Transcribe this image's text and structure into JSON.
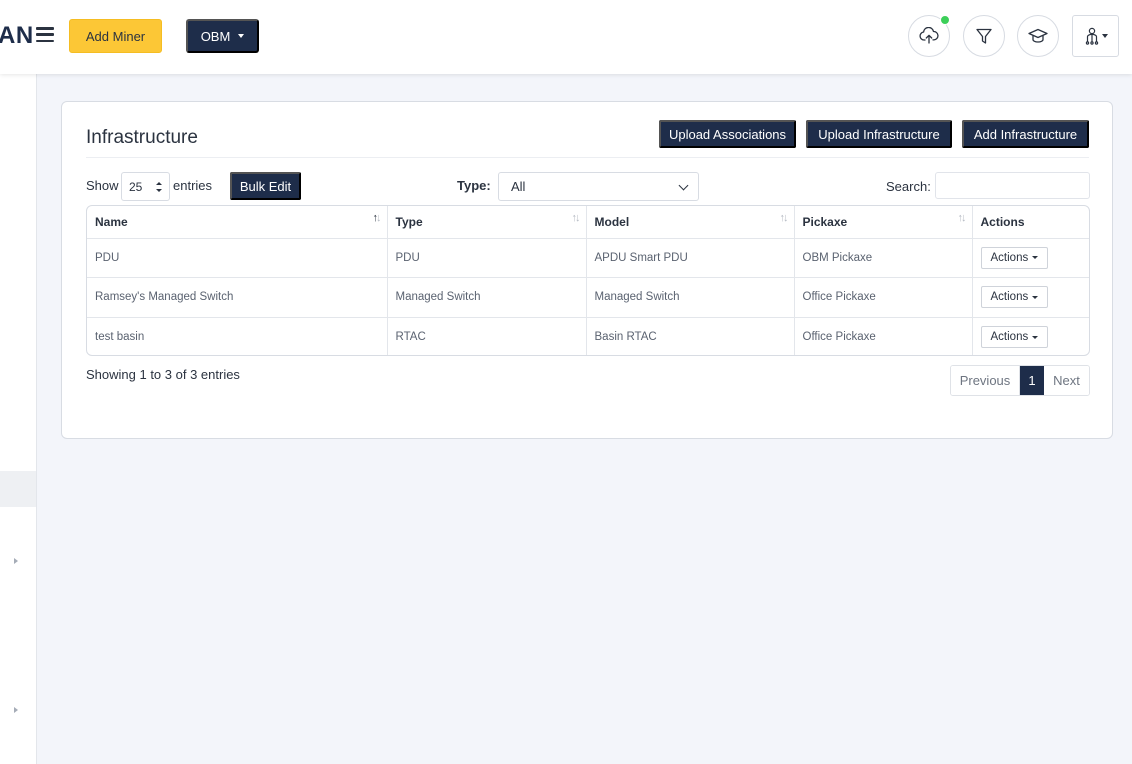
{
  "header": {
    "logo_fragment": "AN",
    "add_miner_label": "Add Miner",
    "org_dropdown_label": "OBM"
  },
  "page": {
    "title": "Infrastructure",
    "buttons": {
      "upload_associations": "Upload Associations",
      "upload_infrastructure": "Upload Infrastructure",
      "add_infrastructure": "Add Infrastructure"
    },
    "show_label": "Show",
    "entries_value": "25",
    "entries_label": "entries",
    "bulk_edit_label": "Bulk Edit",
    "type_label": "Type:",
    "type_value": "All",
    "search_label": "Search:",
    "search_value": ""
  },
  "table": {
    "columns": [
      "Name",
      "Type",
      "Model",
      "Pickaxe",
      "Actions"
    ],
    "rows": [
      {
        "name": "PDU",
        "type": "PDU",
        "model": "APDU Smart PDU",
        "pickaxe": "OBM Pickaxe",
        "action": "Actions"
      },
      {
        "name": "Ramsey's Managed Switch",
        "type": "Managed Switch",
        "model": "Managed Switch",
        "pickaxe": "Office Pickaxe",
        "action": "Actions"
      },
      {
        "name": "test basin",
        "type": "RTAC",
        "model": "Basin RTAC",
        "pickaxe": "Office Pickaxe",
        "action": "Actions"
      }
    ],
    "summary": "Showing 1 to 3 of 3 entries"
  },
  "pagination": {
    "previous": "Previous",
    "current": "1",
    "next": "Next"
  },
  "colors": {
    "accent_yellow": "#fcc736",
    "navy": "#1e2d4a",
    "online_green": "#3ccf59"
  },
  "icons": [
    "menu-icon",
    "cloud-upload-icon",
    "filter-icon",
    "graduation-cap-icon",
    "user-network-icon"
  ]
}
